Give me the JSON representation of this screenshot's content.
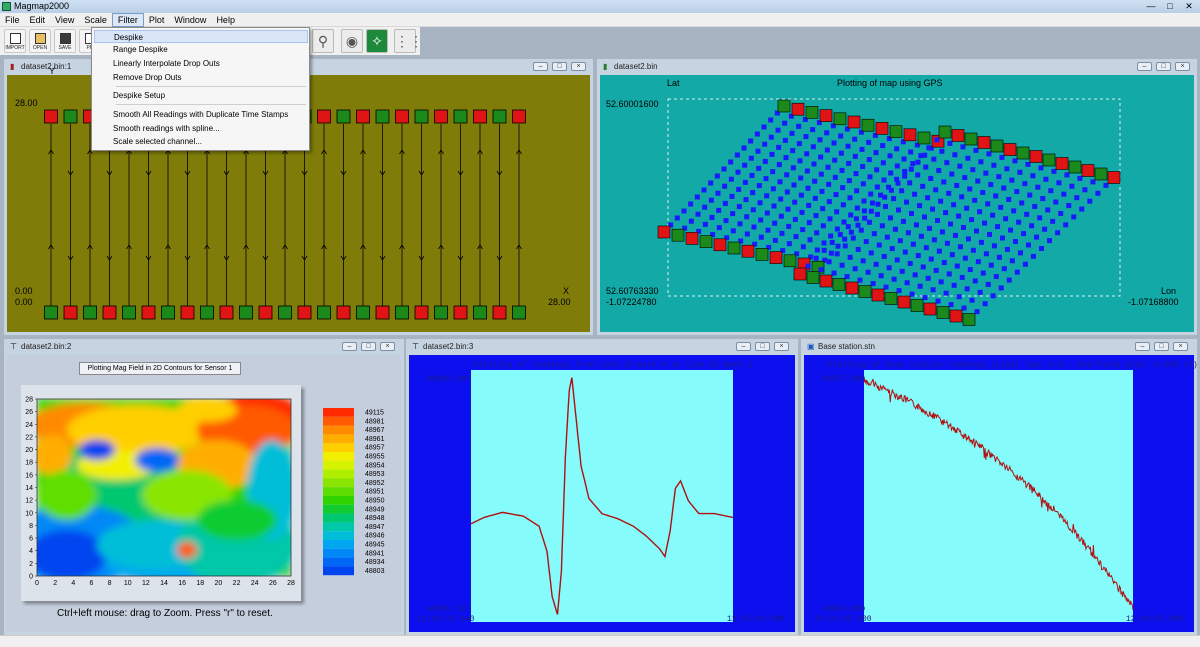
{
  "app": {
    "title": "Magmap2000"
  },
  "menu": [
    "File",
    "Edit",
    "View",
    "Scale",
    "Filter",
    "Plot",
    "Window",
    "Help"
  ],
  "toolbar": {
    "buttons": [
      "IMPORT",
      "OPEN",
      "SAVE",
      "PR"
    ],
    "icons": [
      "zoom-icon",
      "reset-view-icon",
      "fit-view-icon",
      "grid-dots-icon"
    ]
  },
  "filter_menu": {
    "items": [
      "Despike",
      "Range Despike",
      "Linearly Interpolate Drop Outs",
      "Remove Drop Outs"
    ],
    "items2": [
      "Despike Setup"
    ],
    "items3": [
      "Smooth All Readings with Duplicate Time Stamps",
      "Smooth readings with spline...",
      "Scale selected channel..."
    ]
  },
  "windows": {
    "w1": {
      "title": "dataset2.bin:1",
      "y_axis": "Y",
      "x_axis": "X",
      "y_max": "28.00",
      "y_min": "0.00",
      "x_min": "0.00",
      "x_max": "28.00"
    },
    "w2": {
      "title": "dataset2.bin",
      "heading": "Plotting of map using GPS",
      "lat_label": "Lat",
      "lon_label": "Lon",
      "lat_max": "52.60001600",
      "lat_min": "52.60763330",
      "lon_min": "-1.07224780",
      "lon_max": "-1.07168800"
    },
    "w3": {
      "title": "dataset2.bin:2",
      "heading": "Plotting Mag Field in 2D Contours for Sensor 1",
      "hint": "Ctrl+left mouse: drag to Zoom. Press \"r\" to reset.",
      "y_ticks": [
        "28",
        "26",
        "24",
        "22",
        "20",
        "18",
        "16",
        "14",
        "12",
        "10",
        "8",
        "6",
        "4",
        "2",
        "0"
      ],
      "x_ticks": [
        "0",
        "2",
        "4",
        "6",
        "8",
        "10",
        "12",
        "14",
        "16",
        "18",
        "20",
        "22",
        "24",
        "26",
        "28"
      ],
      "legend": [
        "49115",
        "48981",
        "48967",
        "48961",
        "48957",
        "48955",
        "48954",
        "48953",
        "48952",
        "48951",
        "48950",
        "48949",
        "48948",
        "48947",
        "48946",
        "48945",
        "48941",
        "48934",
        "48803"
      ],
      "legend_colors": [
        "#ff2a00",
        "#ff5a00",
        "#ff8a00",
        "#ffae00",
        "#ffcf00",
        "#f3ef00",
        "#d6f400",
        "#b0ee00",
        "#8ae600",
        "#5ede00",
        "#2fd400",
        "#10cc30",
        "#00c870",
        "#00c8a8",
        "#00bed8",
        "#00a6ef",
        "#0088f6",
        "#0066f6",
        "#0044f0"
      ]
    },
    "w4": {
      "title": "dataset2.bin:3",
      "heading": "Plotting of readings from Line 12 mark 0 to line 12 mark 1",
      "y_max": "49006.100",
      "y_min": "48906.767",
      "t_start": "11:14:34.840",
      "t_end": "11:15:10.000"
    },
    "w5": {
      "title": "Base station.stn",
      "heading": "Plotting of base station readings (Limit low: 0.0 - end Field plot: 0.000 nT)",
      "y_max": "48977.000",
      "y_min": "48950.800",
      "t_start": "10:32:45.800",
      "t_end": "12:49:35.800"
    }
  },
  "colors": {
    "accent": "#7f7c09",
    "map_bg": "#12a9a6",
    "plot_bg": "#0c0fee",
    "plot_area": "#86fbfb",
    "trace": "#b01010"
  }
}
